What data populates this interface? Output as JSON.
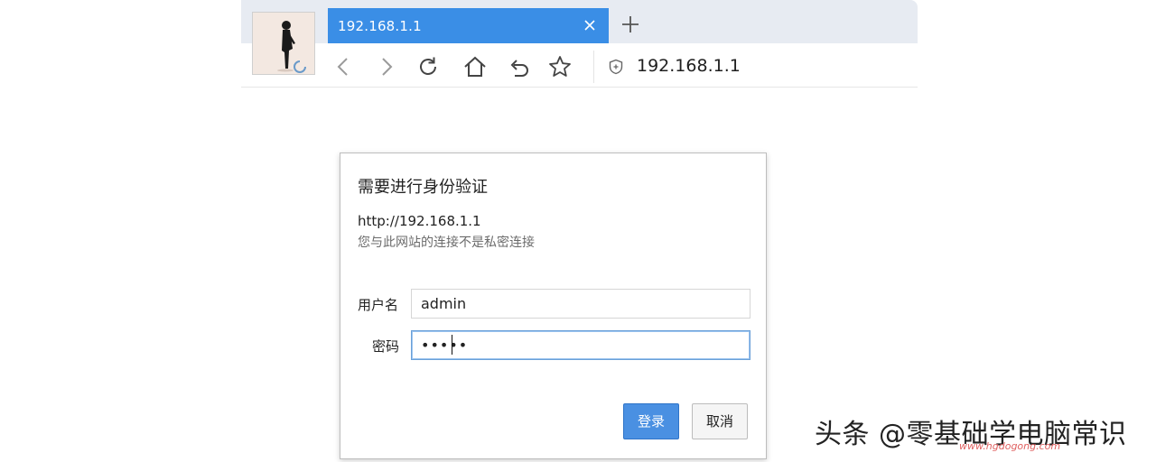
{
  "browser": {
    "tab_title": "192.168.1.1",
    "new_tab_label": "+",
    "address": "192.168.1.1",
    "icons": [
      "back-icon",
      "forward-icon",
      "reload-icon",
      "home-icon",
      "undo-icon",
      "star-icon",
      "shield-icon",
      "close-icon",
      "plus-icon"
    ],
    "accent": "#3a8ee6"
  },
  "dialog": {
    "title": "需要进行身份验证",
    "url": "http://192.168.1.1",
    "note": "您与此网站的连接不是私密连接",
    "username_label": "用户名",
    "username_value": "admin",
    "password_label": "密码",
    "password_value": "•••••",
    "login_label": "登录",
    "cancel_label": "取消",
    "primary_color": "#4a90e2"
  },
  "watermark": {
    "text": "头条 @零基础学电脑常识",
    "url": "www.hgdogong.com"
  }
}
